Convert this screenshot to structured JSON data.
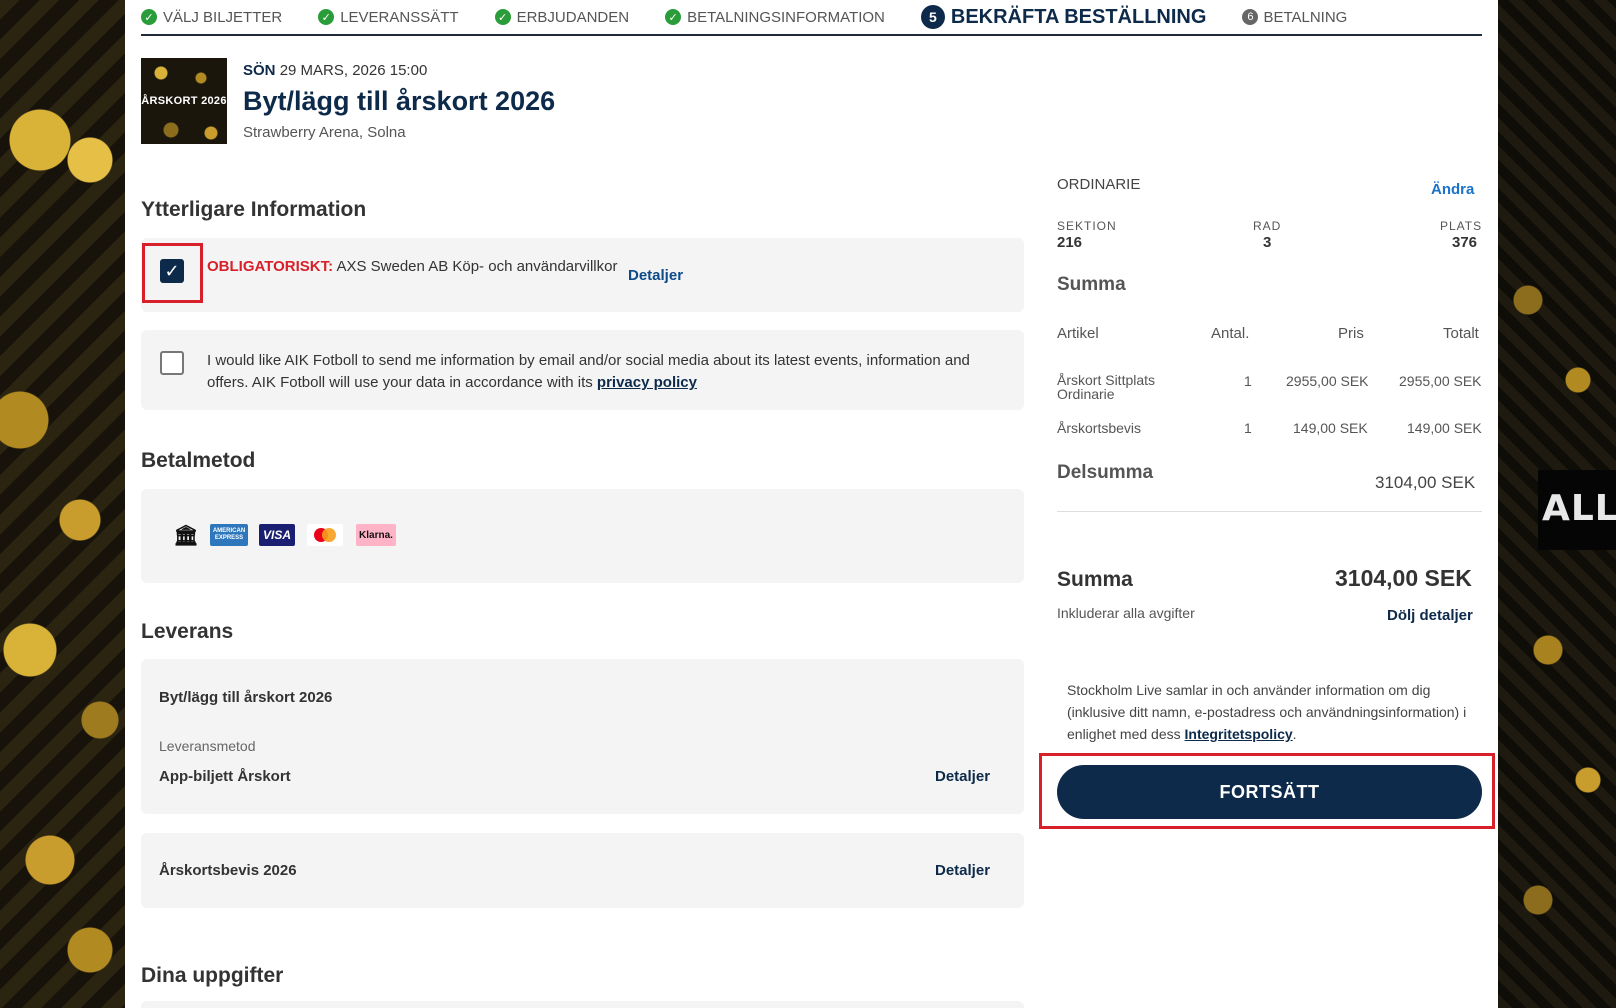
{
  "stepper": {
    "steps": [
      {
        "label": "VÄLJ BILJETTER",
        "state": "done"
      },
      {
        "label": "LEVERANSSÄTT",
        "state": "done"
      },
      {
        "label": "ERBJUDANDEN",
        "state": "done"
      },
      {
        "label": "BETALNINGSINFORMATION",
        "state": "done"
      },
      {
        "num": "5",
        "label": "BEKRÄFTA BESTÄLLNING",
        "state": "active"
      },
      {
        "num": "6",
        "label": "BETALNING",
        "state": "upcoming"
      }
    ]
  },
  "event": {
    "thumb_text": "ÅRSKORT 2026",
    "day": "SÖN",
    "date": "29 MARS, 2026 15:00",
    "title": "Byt/lägg till årskort 2026",
    "venue": "Strawberry Arena, Solna"
  },
  "info": {
    "heading": "Ytterligare Information",
    "terms_required": "OBLIGATORISKT",
    "terms_colon": ":",
    "terms_text": " AXS Sweden AB Köp- och användarvillkor",
    "terms_details": "Detaljer",
    "check_mark": "✓",
    "optin_line1": "I would like AIK Fotboll to send me information by email and/or social media about its latest events, information and",
    "optin_line2": "offers. AIK Fotboll will use your data in accordance with its ",
    "optin_link": "privacy policy"
  },
  "payment": {
    "heading": "Betalmetod",
    "icons": [
      "bank-icon",
      "amex-icon",
      "visa-icon",
      "mastercard-icon",
      "klarna-icon"
    ],
    "bank_glyph": "🏛",
    "amex_label": "AMERICAN EXPRESS",
    "visa_label": "VISA",
    "klarna_label": "Klarna."
  },
  "delivery": {
    "heading": "Leverans",
    "item_title": "Byt/lägg till årskort 2026",
    "method_label": "Leveransmetod",
    "method_value": "App-biljett Årskort",
    "details": "Detaljer",
    "item2_title": "Årskortsbevis 2026",
    "details2": "Detaljer"
  },
  "your_details": {
    "heading": "Dina uppgifter"
  },
  "summary": {
    "ticket_type": "ORDINARIE",
    "change": "Ändra",
    "section_label": "SEKTION",
    "section_value": "216",
    "row_label": "RAD",
    "row_value": "3",
    "seat_label": "PLATS",
    "seat_value": "376",
    "sum_heading": "Summa",
    "columns": [
      "Artikel",
      "Antal.",
      "Pris",
      "Totalt"
    ],
    "rows": [
      {
        "article_l1": "Årskort Sittplats",
        "article_l2": "Ordinarie",
        "qty": "1",
        "price": "2955,00 SEK",
        "total": "2955,00 SEK"
      },
      {
        "article_l1": "Årskortsbevis",
        "article_l2": "",
        "qty": "1",
        "price": "149,00 SEK",
        "total": "149,00 SEK"
      }
    ],
    "subtotal_label": "Delsumma",
    "subtotal_value": "3104,00 SEK",
    "total_label": "Summa",
    "total_value": "3104,00 SEK",
    "includes_fees": "Inkluderar alla avgifter",
    "hide_details": "Dölj detaljer",
    "privacy_l1": "Stockholm Live samlar in och använder information om dig",
    "privacy_l2": "(inklusive ditt namn, e-postadress och användningsinformation) i",
    "privacy_l3a": "enlighet med dess ",
    "privacy_link": "Integritetspolicy",
    "privacy_l3b": ".",
    "continue": "FORTSÄTT"
  },
  "bg_banner": "ALLMÄN"
}
